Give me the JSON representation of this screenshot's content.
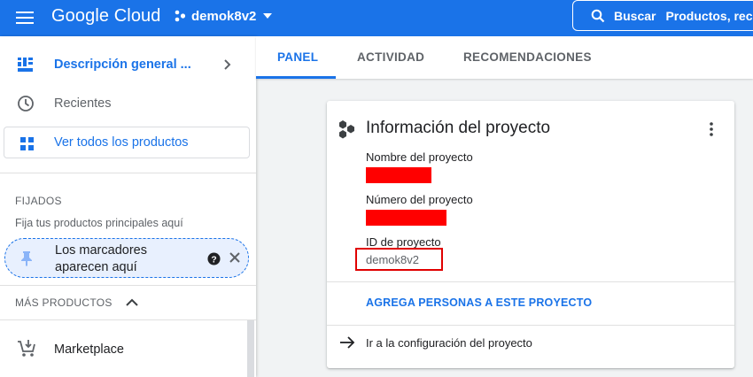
{
  "header": {
    "brand": "Google Cloud",
    "project_name": "demok8v2",
    "search_label": "Buscar",
    "search_placeholder": "Productos, rec"
  },
  "sidebar": {
    "overview": "Descripción general ...",
    "recent": "Recientes",
    "all_products": "Ver todos los productos",
    "pinned_title": "FIJADOS",
    "pinned_hint": "Fija tus productos principales aquí",
    "pinned_card_text": "Los marcadores aparecen aquí",
    "more_products": "MÁS PRODUCTOS",
    "marketplace": "Marketplace"
  },
  "tabs": [
    {
      "label": "PANEL",
      "active": true
    },
    {
      "label": "ACTIVIDAD",
      "active": false
    },
    {
      "label": "RECOMENDACIONES",
      "active": false
    }
  ],
  "project_card": {
    "title": "Información del proyecto",
    "name_label": "Nombre del proyecto",
    "number_label": "Número del proyecto",
    "id_label": "ID de proyecto",
    "id_value": "demok8v2",
    "add_people": "AGREGA PERSONAS A ESTE PROYECTO",
    "goto_settings": "Ir a la configuración del proyecto"
  },
  "colors": {
    "accent": "#1a73e8",
    "redaction": "#ff0000",
    "highlight_border": "#e00000"
  },
  "icons": {
    "menu": "menu-icon",
    "project_picker": "project-dots-icon",
    "search": "search-icon",
    "overview": "dashboard-icon",
    "recent": "clock-icon",
    "all_products": "grid-icon",
    "pin": "pin-icon",
    "help": "help-icon",
    "close": "close-icon",
    "more_products_toggle": "chevron-up-icon",
    "marketplace": "cart-icon",
    "card": "hexagons-icon",
    "kebab": "more-vert-icon",
    "goto": "arrow-right-icon"
  }
}
